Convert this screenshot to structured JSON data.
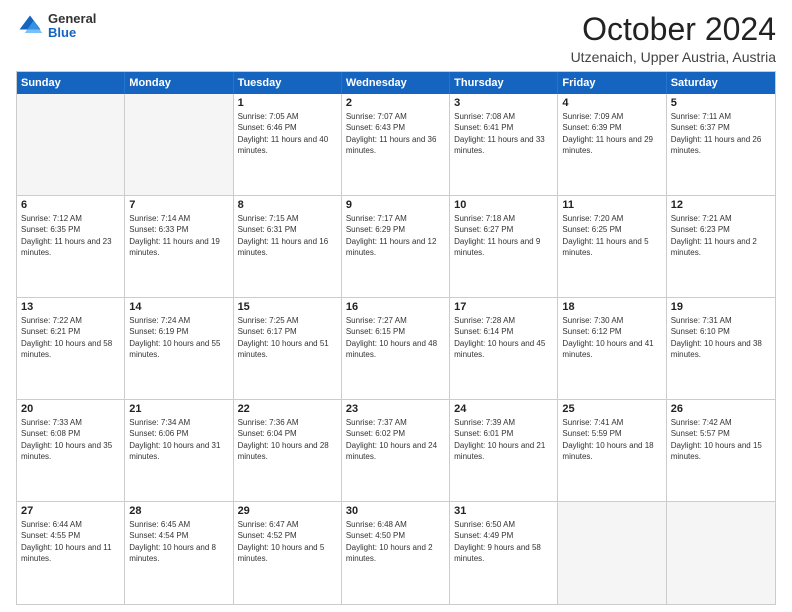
{
  "logo": {
    "general": "General",
    "blue": "Blue"
  },
  "header": {
    "title": "October 2024",
    "subtitle": "Utzenaich, Upper Austria, Austria"
  },
  "weekdays": [
    "Sunday",
    "Monday",
    "Tuesday",
    "Wednesday",
    "Thursday",
    "Friday",
    "Saturday"
  ],
  "weeks": [
    [
      {
        "day": "",
        "sunrise": "",
        "sunset": "",
        "daylight": "",
        "empty": true
      },
      {
        "day": "",
        "sunrise": "",
        "sunset": "",
        "daylight": "",
        "empty": true
      },
      {
        "day": "1",
        "sunrise": "Sunrise: 7:05 AM",
        "sunset": "Sunset: 6:46 PM",
        "daylight": "Daylight: 11 hours and 40 minutes."
      },
      {
        "day": "2",
        "sunrise": "Sunrise: 7:07 AM",
        "sunset": "Sunset: 6:43 PM",
        "daylight": "Daylight: 11 hours and 36 minutes."
      },
      {
        "day": "3",
        "sunrise": "Sunrise: 7:08 AM",
        "sunset": "Sunset: 6:41 PM",
        "daylight": "Daylight: 11 hours and 33 minutes."
      },
      {
        "day": "4",
        "sunrise": "Sunrise: 7:09 AM",
        "sunset": "Sunset: 6:39 PM",
        "daylight": "Daylight: 11 hours and 29 minutes."
      },
      {
        "day": "5",
        "sunrise": "Sunrise: 7:11 AM",
        "sunset": "Sunset: 6:37 PM",
        "daylight": "Daylight: 11 hours and 26 minutes."
      }
    ],
    [
      {
        "day": "6",
        "sunrise": "Sunrise: 7:12 AM",
        "sunset": "Sunset: 6:35 PM",
        "daylight": "Daylight: 11 hours and 23 minutes."
      },
      {
        "day": "7",
        "sunrise": "Sunrise: 7:14 AM",
        "sunset": "Sunset: 6:33 PM",
        "daylight": "Daylight: 11 hours and 19 minutes."
      },
      {
        "day": "8",
        "sunrise": "Sunrise: 7:15 AM",
        "sunset": "Sunset: 6:31 PM",
        "daylight": "Daylight: 11 hours and 16 minutes."
      },
      {
        "day": "9",
        "sunrise": "Sunrise: 7:17 AM",
        "sunset": "Sunset: 6:29 PM",
        "daylight": "Daylight: 11 hours and 12 minutes."
      },
      {
        "day": "10",
        "sunrise": "Sunrise: 7:18 AM",
        "sunset": "Sunset: 6:27 PM",
        "daylight": "Daylight: 11 hours and 9 minutes."
      },
      {
        "day": "11",
        "sunrise": "Sunrise: 7:20 AM",
        "sunset": "Sunset: 6:25 PM",
        "daylight": "Daylight: 11 hours and 5 minutes."
      },
      {
        "day": "12",
        "sunrise": "Sunrise: 7:21 AM",
        "sunset": "Sunset: 6:23 PM",
        "daylight": "Daylight: 11 hours and 2 minutes."
      }
    ],
    [
      {
        "day": "13",
        "sunrise": "Sunrise: 7:22 AM",
        "sunset": "Sunset: 6:21 PM",
        "daylight": "Daylight: 10 hours and 58 minutes."
      },
      {
        "day": "14",
        "sunrise": "Sunrise: 7:24 AM",
        "sunset": "Sunset: 6:19 PM",
        "daylight": "Daylight: 10 hours and 55 minutes."
      },
      {
        "day": "15",
        "sunrise": "Sunrise: 7:25 AM",
        "sunset": "Sunset: 6:17 PM",
        "daylight": "Daylight: 10 hours and 51 minutes."
      },
      {
        "day": "16",
        "sunrise": "Sunrise: 7:27 AM",
        "sunset": "Sunset: 6:15 PM",
        "daylight": "Daylight: 10 hours and 48 minutes."
      },
      {
        "day": "17",
        "sunrise": "Sunrise: 7:28 AM",
        "sunset": "Sunset: 6:14 PM",
        "daylight": "Daylight: 10 hours and 45 minutes."
      },
      {
        "day": "18",
        "sunrise": "Sunrise: 7:30 AM",
        "sunset": "Sunset: 6:12 PM",
        "daylight": "Daylight: 10 hours and 41 minutes."
      },
      {
        "day": "19",
        "sunrise": "Sunrise: 7:31 AM",
        "sunset": "Sunset: 6:10 PM",
        "daylight": "Daylight: 10 hours and 38 minutes."
      }
    ],
    [
      {
        "day": "20",
        "sunrise": "Sunrise: 7:33 AM",
        "sunset": "Sunset: 6:08 PM",
        "daylight": "Daylight: 10 hours and 35 minutes."
      },
      {
        "day": "21",
        "sunrise": "Sunrise: 7:34 AM",
        "sunset": "Sunset: 6:06 PM",
        "daylight": "Daylight: 10 hours and 31 minutes."
      },
      {
        "day": "22",
        "sunrise": "Sunrise: 7:36 AM",
        "sunset": "Sunset: 6:04 PM",
        "daylight": "Daylight: 10 hours and 28 minutes."
      },
      {
        "day": "23",
        "sunrise": "Sunrise: 7:37 AM",
        "sunset": "Sunset: 6:02 PM",
        "daylight": "Daylight: 10 hours and 24 minutes."
      },
      {
        "day": "24",
        "sunrise": "Sunrise: 7:39 AM",
        "sunset": "Sunset: 6:01 PM",
        "daylight": "Daylight: 10 hours and 21 minutes."
      },
      {
        "day": "25",
        "sunrise": "Sunrise: 7:41 AM",
        "sunset": "Sunset: 5:59 PM",
        "daylight": "Daylight: 10 hours and 18 minutes."
      },
      {
        "day": "26",
        "sunrise": "Sunrise: 7:42 AM",
        "sunset": "Sunset: 5:57 PM",
        "daylight": "Daylight: 10 hours and 15 minutes."
      }
    ],
    [
      {
        "day": "27",
        "sunrise": "Sunrise: 6:44 AM",
        "sunset": "Sunset: 4:55 PM",
        "daylight": "Daylight: 10 hours and 11 minutes."
      },
      {
        "day": "28",
        "sunrise": "Sunrise: 6:45 AM",
        "sunset": "Sunset: 4:54 PM",
        "daylight": "Daylight: 10 hours and 8 minutes."
      },
      {
        "day": "29",
        "sunrise": "Sunrise: 6:47 AM",
        "sunset": "Sunset: 4:52 PM",
        "daylight": "Daylight: 10 hours and 5 minutes."
      },
      {
        "day": "30",
        "sunrise": "Sunrise: 6:48 AM",
        "sunset": "Sunset: 4:50 PM",
        "daylight": "Daylight: 10 hours and 2 minutes."
      },
      {
        "day": "31",
        "sunrise": "Sunrise: 6:50 AM",
        "sunset": "Sunset: 4:49 PM",
        "daylight": "Daylight: 9 hours and 58 minutes."
      },
      {
        "day": "",
        "sunrise": "",
        "sunset": "",
        "daylight": "",
        "empty": true
      },
      {
        "day": "",
        "sunrise": "",
        "sunset": "",
        "daylight": "",
        "empty": true
      }
    ]
  ]
}
